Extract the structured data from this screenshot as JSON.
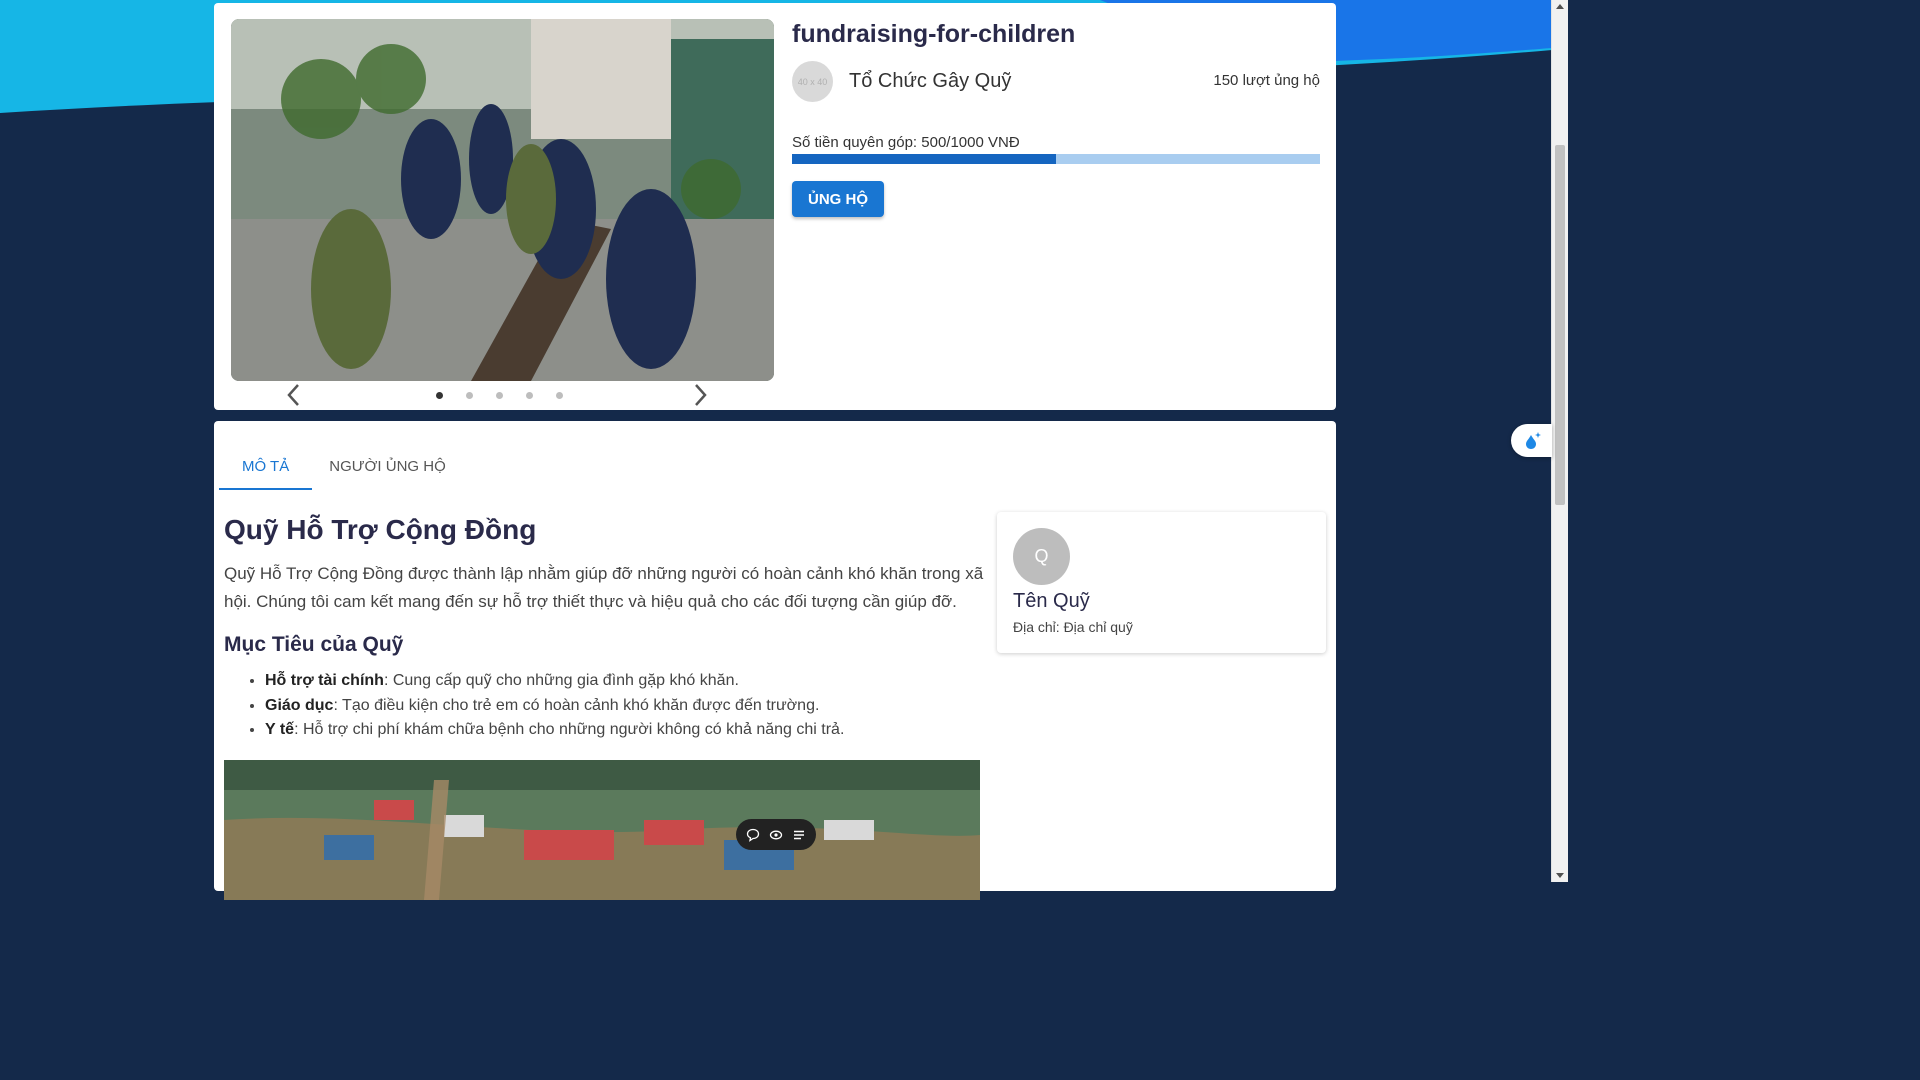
{
  "campaign": {
    "title": "fundraising-for-children",
    "org_avatar_placeholder": "40 x 40",
    "org_name": "Tổ Chức Gây Quỹ",
    "supports_count": "150 lượt ủng hộ",
    "amount_label": "Số tiền quyên góp: 500/1000 VNĐ",
    "progress_fraction": 0.5,
    "support_button": "ỦNG HỘ",
    "carousel_slides": 5,
    "carousel_active": 0
  },
  "tabs": [
    {
      "label": "MÔ TẢ",
      "active": true
    },
    {
      "label": "NGƯỜI ỦNG HỘ",
      "active": false
    }
  ],
  "description": {
    "heading": "Quỹ Hỗ Trợ Cộng Đồng",
    "paragraph": "Quỹ Hỗ Trợ Cộng Đồng được thành lập nhằm giúp đỡ những người có hoàn cảnh khó khăn trong xã hội. Chúng tôi cam kết mang đến sự hỗ trợ thiết thực và hiệu quả cho các đối tượng cần giúp đỡ.",
    "goals_heading": "Mục Tiêu của Quỹ",
    "goals": [
      {
        "term": "Hỗ trợ tài chính",
        "text": ": Cung cấp quỹ cho những gia đình gặp khó khăn."
      },
      {
        "term": "Giáo dục",
        "text": ": Tạo điều kiện cho trẻ em có hoàn cảnh khó khăn được đến trường."
      },
      {
        "term": "Y tế",
        "text": ": Hỗ trợ chi phí khám chữa bệnh cho những người không có khả năng chi trả."
      }
    ]
  },
  "fund_card": {
    "avatar_letter": "Q",
    "name": "Tên Quỹ",
    "address": "Địa chỉ: Địa chỉ quỹ"
  },
  "colors": {
    "accent": "#1976d2",
    "background": "#14294a",
    "wave": "#1aa7e8"
  },
  "icons": {
    "carousel_prev": "chevron-left-icon",
    "carousel_next": "chevron-right-icon",
    "toolbar": [
      "comment-icon",
      "eye-icon",
      "list-icon"
    ],
    "side_widget": "water-drop-sparkle-icon"
  }
}
